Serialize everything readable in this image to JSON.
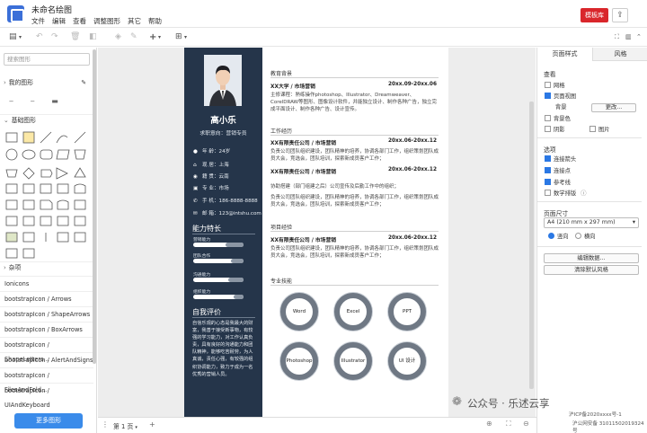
{
  "app": {
    "title": "未命名绘图",
    "menu": [
      "文件",
      "编辑",
      "查看",
      "调整图形",
      "其它",
      "帮助"
    ],
    "template_btn": "模板库"
  },
  "left_panel": {
    "search_placeholder": "搜索图形",
    "my_shapes": "我的图形",
    "basic_shapes": "基础图形",
    "misc": "杂项",
    "libraries": [
      "Ionicons",
      "bootstrapIcon / Arrows",
      "bootstrapIcon / ShapeArrows",
      "bootstrapIcon / BoxArrows",
      "bootstrapIcon / ShapeLetters...",
      "bootstrapIcon / AlertAndSigns",
      "bootstrapIcon / FilesAndFold...",
      "bootstrapIcon / UIAndKeyboard"
    ],
    "more_shapes": "更多图形"
  },
  "resume": {
    "name": "高小乐",
    "intent": "求职意向：营销专员",
    "info": [
      {
        "icon": "person-icon",
        "text": "年 龄：24岁"
      },
      {
        "icon": "home-icon",
        "text": "现 居：上海"
      },
      {
        "icon": "location-icon",
        "text": "籍 贯：云南"
      },
      {
        "icon": "book-icon",
        "text": "专 业：市场"
      },
      {
        "icon": "phone-icon",
        "text": "手 机：186-8888-8888"
      },
      {
        "icon": "mail-icon",
        "text": "邮 箱：123@intshu.com"
      }
    ],
    "skills_title": "能力特长",
    "skills": [
      {
        "label": "营销能力",
        "level": 0.35
      },
      {
        "label": "团队合作",
        "level": 0.25
      },
      {
        "label": "沟通能力",
        "level": 0.3
      },
      {
        "label": "组织能力",
        "level": 0.2
      }
    ],
    "eval_title": "自我评价",
    "eval_text": "自信乐观的心态是我最大的财富，我善于接受新事物，有较强的学习能力，对工作认真负责，具有良好的沟通能力和团队精神，能够吃苦耐劳，为人真诚，责任心强，有较强的组织协调能力，致力于成为一名优秀的营销人员。",
    "education_title": "教育背景",
    "education": {
      "school": "XX大学 / 市场营销",
      "date": "20xx.09-20xx.06",
      "desc": "主修课程：熟练操作photoshop、Illustrator、Dreamweaver、CorelDRAW等图形、图像设计软件，并能独立设计、制作各种广告，独立完成平面设计、制作各种广告、设计宣传。"
    },
    "work_title": "工作经历",
    "work": [
      {
        "company": "XX有限责任公司 / 市场营销",
        "date": "20xx.06-20xx.12",
        "desc": "负责公司团队组织建设，团队精神的培养，协调各部门工作，组织策划团队成员大会，竞选会，团队培训，探索新成员客户工作；"
      },
      {
        "company": "XX有限责任公司 / 市场营销",
        "date": "20xx.06-20xx.12",
        "desc": "协助搭建（部门组建之后）公司宣传及后勤工作中的组织；"
      },
      {
        "company": "",
        "date": "",
        "desc": "负责公司团队组织建设，团队精神的培养，协调各部门工作，组织策划团队成员大会，竞选会，团队培训，探索新成员客户工作；"
      }
    ],
    "project_title": "项目经验",
    "project": {
      "company": "XX有限责任公司 / 市场营销",
      "date": "20xx.06-20xx.12",
      "desc": "负责公司团队组织建设，团队精神的培养，协调各部门工作，组织策划团队成员大会，竞选会，团队培训，探索新成员客户工作；"
    },
    "pro_skills_title": "专业技能",
    "pro_skills": [
      "Word",
      "Excel",
      "PPT",
      "Photoshop",
      "Illustrator",
      "UI 设计"
    ]
  },
  "right_panel": {
    "tabs": [
      "页面样式",
      "风格"
    ],
    "view_title": "查看",
    "grid": "网格",
    "page_view": "页面视图",
    "background": "背景",
    "change_btn": "更改...",
    "bg_color": "背景色",
    "shadow": "阴影",
    "image": "图片",
    "options_title": "选项",
    "connect_arrows": "连接箭头",
    "connect_points": "连接点",
    "guides": "参考线",
    "math": "数学排版",
    "paper_size_title": "页面尺寸",
    "paper_size": "A4 (210 mm x 297 mm)",
    "portrait": "竖向",
    "landscape": "横向",
    "edit_data_btn": "编辑数据...",
    "clear_style_btn": "清除默认风格"
  },
  "bottom": {
    "page_tab": "第 1 页",
    "watermark": "公众号 · 乐述云享",
    "icp1": "沪ICP备2020xxxx号-1",
    "icp2": "沪公网安备 31011502019324号"
  },
  "colors": {
    "sidebar": "#25354a",
    "accent": "#d9262b",
    "primary": "#3a8bea"
  }
}
